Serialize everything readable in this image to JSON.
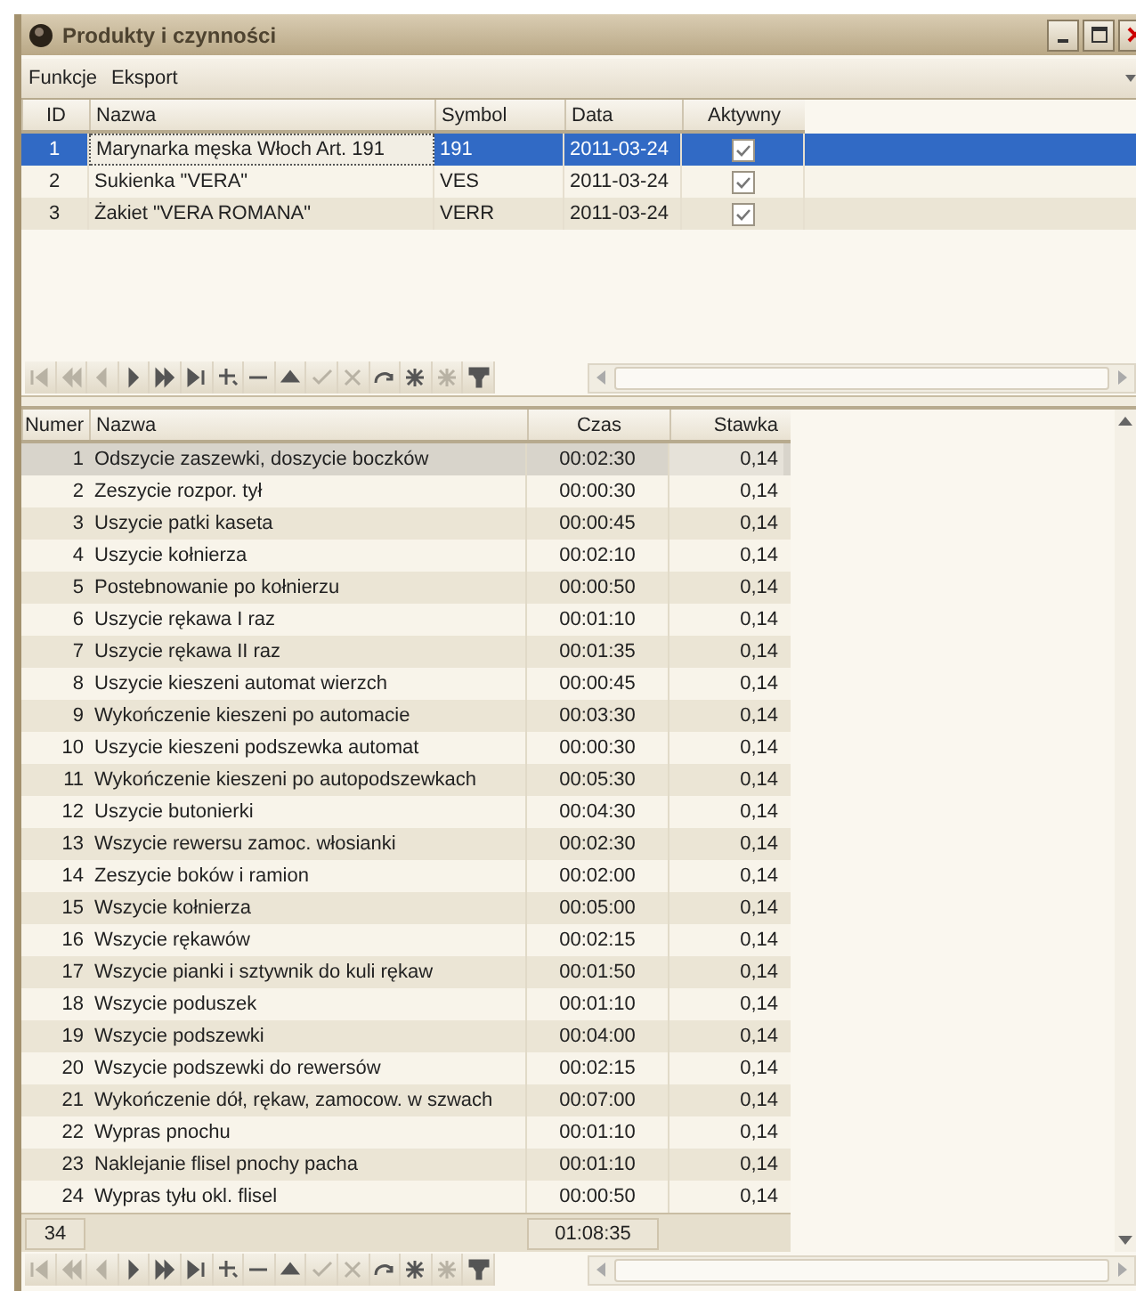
{
  "window": {
    "title": "Produkty i czynności"
  },
  "menu": [
    "Funkcje",
    "Eksport"
  ],
  "products": {
    "columns": [
      {
        "label": "ID",
        "current": false
      },
      {
        "label": "Nazwa",
        "current": true
      },
      {
        "label": "Symbol",
        "current": false
      },
      {
        "label": "Data",
        "current": false
      },
      {
        "label": "Aktywny",
        "current": false
      }
    ],
    "rows": [
      {
        "id": "1",
        "name": "Marynarka męska Włoch Art. 191",
        "symbol": "191",
        "date": "2011-03-24",
        "active": true,
        "selected": true
      },
      {
        "id": "2",
        "name": "Sukienka \"VERA\"",
        "symbol": "VES",
        "date": "2011-03-24",
        "active": true,
        "selected": false
      },
      {
        "id": "3",
        "name": "Żakiet \"VERA ROMANA\"",
        "symbol": "VERR",
        "date": "2011-03-24",
        "active": true,
        "selected": false
      }
    ]
  },
  "navigator": [
    {
      "kind": "first",
      "disabled": true
    },
    {
      "kind": "prior",
      "disabled": true
    },
    {
      "kind": "prev",
      "disabled": true
    },
    {
      "kind": "next",
      "disabled": false
    },
    {
      "kind": "later",
      "disabled": false
    },
    {
      "kind": "last",
      "disabled": false
    },
    {
      "kind": "insert",
      "disabled": false
    },
    {
      "kind": "delete",
      "disabled": false
    },
    {
      "kind": "edit",
      "disabled": false
    },
    {
      "kind": "post",
      "disabled": true
    },
    {
      "kind": "cancel",
      "disabled": true
    },
    {
      "kind": "refresh",
      "disabled": false
    },
    {
      "kind": "bookmark",
      "disabled": false
    },
    {
      "kind": "gotobookmark",
      "disabled": true
    },
    {
      "kind": "filter",
      "disabled": false
    }
  ],
  "activities": {
    "columns": [
      "Numer",
      "Nazwa",
      "Czas",
      "Stawka"
    ],
    "rows": [
      {
        "number": "1",
        "name": "Odszycie zaszewki, doszycie boczków",
        "time": "00:02:30",
        "rate": "0,14",
        "selected": true
      },
      {
        "number": "2",
        "name": "Zeszycie rozpor. tył",
        "time": "00:00:30",
        "rate": "0,14",
        "selected": false
      },
      {
        "number": "3",
        "name": "Uszycie patki kaseta",
        "time": "00:00:45",
        "rate": "0,14",
        "selected": false
      },
      {
        "number": "4",
        "name": "Uszycie kołnierza",
        "time": "00:02:10",
        "rate": "0,14",
        "selected": false
      },
      {
        "number": "5",
        "name": "Postebnowanie po kołnierzu",
        "time": "00:00:50",
        "rate": "0,14",
        "selected": false
      },
      {
        "number": "6",
        "name": "Uszycie rękawa I raz",
        "time": "00:01:10",
        "rate": "0,14",
        "selected": false
      },
      {
        "number": "7",
        "name": "Uszycie rękawa II raz",
        "time": "00:01:35",
        "rate": "0,14",
        "selected": false
      },
      {
        "number": "8",
        "name": "Uszycie kieszeni automat wierzch",
        "time": "00:00:45",
        "rate": "0,14",
        "selected": false
      },
      {
        "number": "9",
        "name": "Wykończenie kieszeni po automacie",
        "time": "00:03:30",
        "rate": "0,14",
        "selected": false
      },
      {
        "number": "10",
        "name": "Uszycie kieszeni podszewka automat",
        "time": "00:00:30",
        "rate": "0,14",
        "selected": false
      },
      {
        "number": "11",
        "name": "Wykończenie kieszeni po autopodszewkach",
        "time": "00:05:30",
        "rate": "0,14",
        "selected": false
      },
      {
        "number": "12",
        "name": "Uszycie butonierki",
        "time": "00:04:30",
        "rate": "0,14",
        "selected": false
      },
      {
        "number": "13",
        "name": "Wszycie rewersu zamoc. włosianki",
        "time": "00:02:30",
        "rate": "0,14",
        "selected": false
      },
      {
        "number": "14",
        "name": "Zeszycie boków i ramion",
        "time": "00:02:00",
        "rate": "0,14",
        "selected": false
      },
      {
        "number": "15",
        "name": "Wszycie kołnierza",
        "time": "00:05:00",
        "rate": "0,14",
        "selected": false
      },
      {
        "number": "16",
        "name": "Wszycie rękawów",
        "time": "00:02:15",
        "rate": "0,14",
        "selected": false
      },
      {
        "number": "17",
        "name": "Wszycie pianki i sztywnik do kuli rękaw",
        "time": "00:01:50",
        "rate": "0,14",
        "selected": false
      },
      {
        "number": "18",
        "name": "Wszycie poduszek",
        "time": "00:01:10",
        "rate": "0,14",
        "selected": false
      },
      {
        "number": "19",
        "name": "Wszycie podszewki",
        "time": "00:04:00",
        "rate": "0,14",
        "selected": false
      },
      {
        "number": "20",
        "name": "Wszycie podszewki do rewersów",
        "time": "00:02:15",
        "rate": "0,14",
        "selected": false
      },
      {
        "number": "21",
        "name": "Wykończenie dół, rękaw, zamocow. w szwach",
        "time": "00:07:00",
        "rate": "0,14",
        "selected": false
      },
      {
        "number": "22",
        "name": "Wypras pnochu",
        "time": "00:01:10",
        "rate": "0,14",
        "selected": false
      },
      {
        "number": "23",
        "name": "Naklejanie flisel pnochy pacha",
        "time": "00:01:10",
        "rate": "0,14",
        "selected": false
      },
      {
        "number": "24",
        "name": "Wypras tyłu okl. flisel",
        "time": "00:00:50",
        "rate": "0,14",
        "selected": false
      }
    ],
    "footer": {
      "count": "34",
      "total_time": "01:08:35"
    }
  }
}
